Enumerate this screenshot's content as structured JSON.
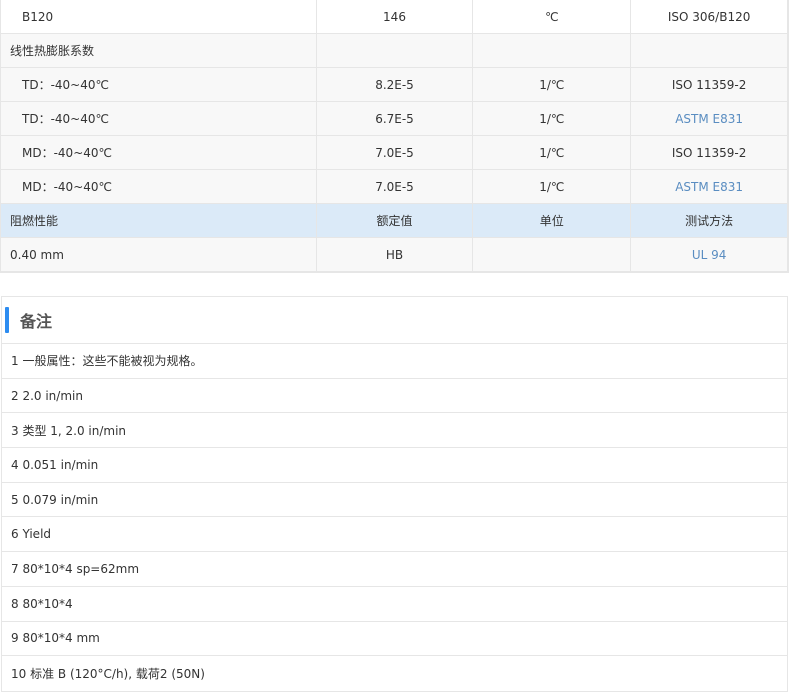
{
  "table": {
    "rows": [
      {
        "c1": "B120",
        "c2": "146",
        "c3": "℃",
        "c4": "ISO 306/B120",
        "c4_link": false,
        "style": "plain",
        "indent": true
      },
      {
        "c1": "线性热膨胀系数",
        "c2": "",
        "c3": "",
        "c4": "",
        "c4_link": false,
        "style": "gray",
        "indent": false
      },
      {
        "c1": "TD：-40~40℃",
        "c2": "8.2E-5",
        "c3": "1/℃",
        "c4": "ISO 11359-2",
        "c4_link": false,
        "style": "gray",
        "indent": true
      },
      {
        "c1": "TD：-40~40℃",
        "c2": "6.7E-5",
        "c3": "1/℃",
        "c4": "ASTM E831",
        "c4_link": true,
        "style": "gray",
        "indent": true
      },
      {
        "c1": "MD：-40~40℃",
        "c2": "7.0E-5",
        "c3": "1/℃",
        "c4": "ISO 11359-2",
        "c4_link": false,
        "style": "gray",
        "indent": true
      },
      {
        "c1": "MD：-40~40℃",
        "c2": "7.0E-5",
        "c3": "1/℃",
        "c4": "ASTM E831",
        "c4_link": true,
        "style": "gray",
        "indent": true
      },
      {
        "c1": "阻燃性能",
        "c2": "额定值",
        "c3": "单位",
        "c4": "测试方法",
        "c4_link": false,
        "style": "blue",
        "indent": false
      },
      {
        "c1": "0.40 mm",
        "c2": "HB",
        "c3": "",
        "c4": "UL 94",
        "c4_link": true,
        "style": "gray",
        "indent": false
      }
    ]
  },
  "notes": {
    "title": "备注",
    "items": [
      "1 一般属性：这些不能被视为规格。",
      "2 2.0 in/min",
      "3 类型 1, 2.0 in/min",
      "4 0.051 in/min",
      "5 0.079 in/min",
      "6 Yield",
      "7 80*10*4 sp=62mm",
      "8 80*10*4",
      "9 80*10*4 mm",
      "10 标准 B (120°C/h), 载荷2 (50N)"
    ]
  }
}
